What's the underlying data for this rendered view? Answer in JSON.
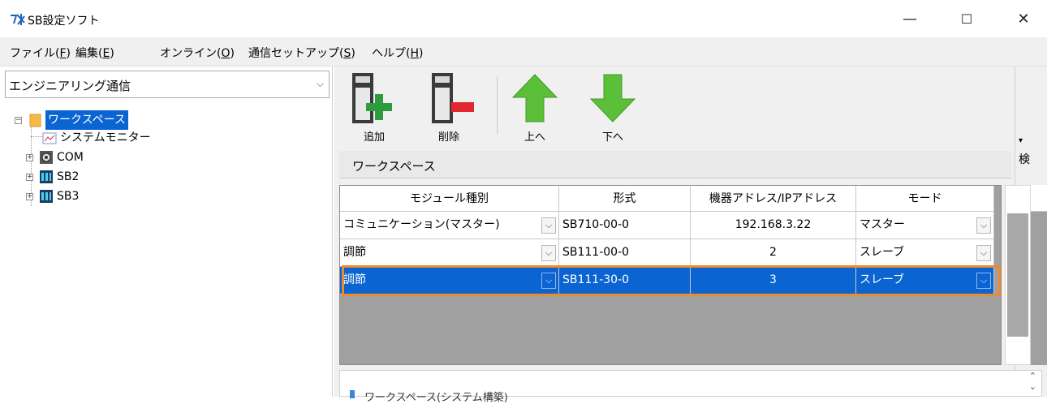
{
  "window": {
    "title": "SB設定ソフト",
    "minimize_label": "—",
    "maximize_label": "☐",
    "close_label": "✕"
  },
  "menu": [
    {
      "text": "ファイル(",
      "key": "F",
      "end": ")"
    },
    {
      "text": "編集(",
      "key": "E",
      "end": ")"
    },
    {
      "text": "オンライン(",
      "key": "O",
      "end": ")"
    },
    {
      "text": "通信セットアップ(",
      "key": "S",
      "end": ")"
    },
    {
      "text": "ヘルプ(",
      "key": "H",
      "end": ")"
    }
  ],
  "left": {
    "combo_value": "エンジニアリング通信",
    "tree": {
      "root": "ワークスペース",
      "system_monitor": "システムモニター",
      "com": "COM",
      "sb2": "SB2",
      "sb3": "SB3"
    }
  },
  "toolbar": {
    "add": "追加",
    "delete": "削除",
    "up": "上へ",
    "down": "下へ"
  },
  "side_strip_label": "検",
  "section_title": "ワークスペース",
  "table": {
    "headers": [
      "モジュール種別",
      "形式",
      "機器アドレス/IPアドレス",
      "モード"
    ],
    "rows": [
      {
        "type": "コミュニケーション(マスター)",
        "model": "SB710-00-0",
        "address": "192.168.3.22",
        "mode": "マスター"
      },
      {
        "type": "調節",
        "model": "SB111-00-0",
        "address": "2",
        "mode": "スレーブ"
      },
      {
        "type": "調節",
        "model": "SB111-30-0",
        "address": "3",
        "mode": "スレーブ"
      }
    ]
  },
  "bottom_panel_text": "ワークスペース(システム構築)",
  "colors": {
    "selection": "#0a64d2",
    "highlight_outline": "#f08a2c",
    "add_plus": "#2e9b3e",
    "delete_minus": "#e0262f",
    "arrow_green": "#5cbf3a"
  }
}
